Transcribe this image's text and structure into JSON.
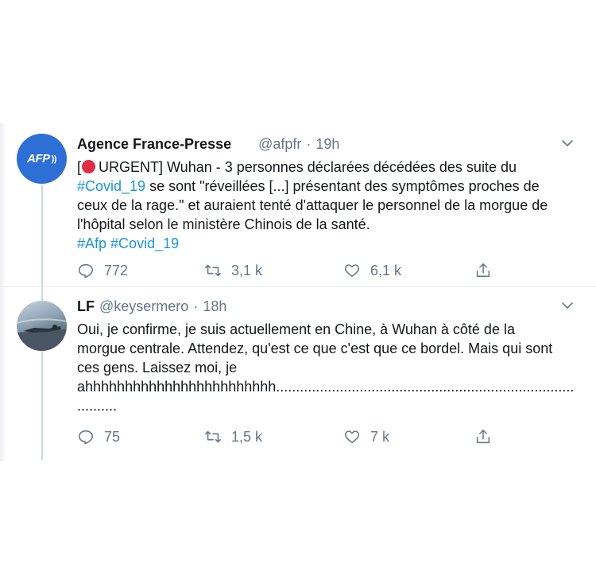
{
  "tweets": [
    {
      "author_name": "Agence France-Presse",
      "handle": "@afpfr",
      "separator": "·",
      "time": "19h",
      "avatar_text": "AFP",
      "lines": {
        "l1_open": "[",
        "l1_rest": "URGENT] Wuhan - 3 personnes déclarées décédées des suite du",
        "l2_tag": "#Covid_19",
        "l2_rest": " se sont \"réveillées [...] présentant des symptômes proches de",
        "l3": "ceux de la rage.\" et auraient tenté d'attaquer le personnel de la morgue de",
        "l4": "l'hôpital selon le ministère Chinois de la santé.",
        "l5_tag1": "#Afp",
        "l5_tag2": "#Covid_19"
      },
      "actions": {
        "replies": "772",
        "retweets": "3,1 k",
        "likes": "6,1 k"
      }
    },
    {
      "author_name": "LF",
      "handle": "@keysermero",
      "separator": "·",
      "time": "18h",
      "lines": {
        "l1": "Oui, je confirme, je suis actuellement en Chine, à Wuhan à côté de la",
        "l2": "morgue centrale. Attendez, qu'est ce que c'est que ce bordel. Mais qui sont",
        "l3": "ces gens. Laissez moi, je",
        "l4": "ahhhhhhhhhhhhhhhhhhhhhhhh...........................................................................",
        "l5": ".........."
      },
      "actions": {
        "replies": "75",
        "retweets": "1,5 k",
        "likes": "7 k"
      }
    }
  ],
  "icons": {
    "reply": "reply-icon",
    "retweet": "retweet-icon",
    "like": "heart-icon",
    "share": "share-icon",
    "menu": "chevron-down-icon",
    "urgent": "red-circle-icon"
  },
  "colors": {
    "link": "#1b95e0",
    "muted": "#657786",
    "afp_blue": "#2e6fd6",
    "urgent_red": "#dd2e44",
    "thread_line": "#ccd6dd"
  }
}
